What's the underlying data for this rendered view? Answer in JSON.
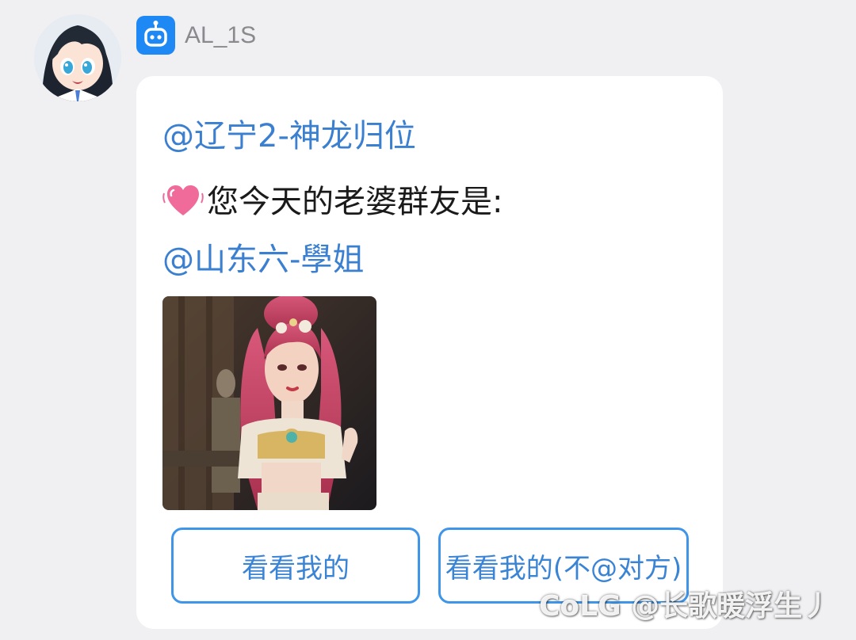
{
  "sender": {
    "name": "AL_1S",
    "avatar_icon": "anime-girl-avatar",
    "badge_icon": "robot-icon",
    "badge_color": "#1e88f5"
  },
  "message": {
    "mention_1": "@辽宁2-神龙归位",
    "emoji_icon": "beating-heart-emoji",
    "text": "您今天的老婆群友是:",
    "mention_2": "@山东六-學姐",
    "image_icon": "anime-character-portrait",
    "mention_color": "#3a7fd0"
  },
  "buttons": {
    "view_mine": "看看我的",
    "view_mine_no_at": "看看我的(不@对方)",
    "accent": "#3f95e8"
  },
  "watermark": "CoLG @长歌暖浮生丿"
}
